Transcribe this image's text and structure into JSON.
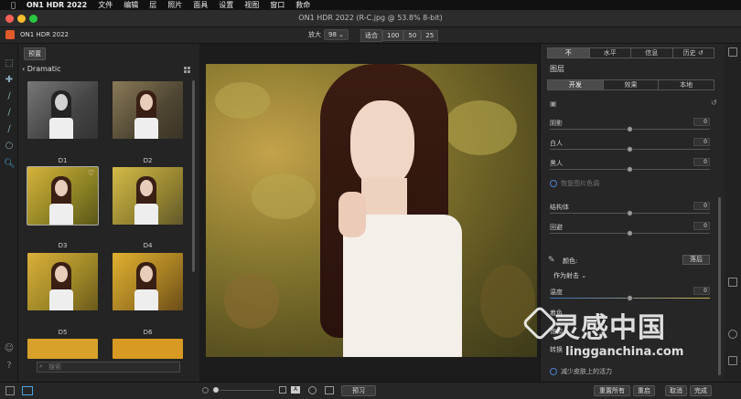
{
  "menubar": {
    "apple": "",
    "app": "ON1 HDR 2022",
    "items": [
      "文件",
      "编辑",
      "层",
      "照片",
      "面具",
      "设置",
      "视图",
      "窗口",
      "救命"
    ]
  },
  "window": {
    "title": "ON1 HDR 2022 (R-C.jpg @ 53.8% 8-bit)"
  },
  "toolbar": {
    "app_name": "ON1 HDR 2022",
    "zoom_label": "放大",
    "zoom_value": "98",
    "fit_label": "适合",
    "zoom_options": [
      "100",
      "50",
      "25"
    ]
  },
  "browser": {
    "tab_label": "预置",
    "folder_name": "Dramatic",
    "thumbnails": [
      "D1",
      "D2",
      "D3",
      "D4",
      "D5",
      "D6"
    ],
    "search_placeholder": "搜索"
  },
  "right_panel": {
    "tabs": [
      "不",
      "水平",
      "信息",
      "历史"
    ],
    "layers_title": "图层",
    "subtabs": [
      "开发",
      "效果",
      "本地"
    ],
    "sliders": [
      {
        "label": "阴影",
        "value": "0",
        "position": 0.5
      },
      {
        "label": "白人",
        "value": "0",
        "position": 0.5
      },
      {
        "label": "黑人",
        "value": "0",
        "position": 0.5
      },
      {
        "label": "结构体",
        "value": "0",
        "position": 0.5
      },
      {
        "label": "回避",
        "value": "0",
        "position": 0.5
      },
      {
        "label": "温度",
        "value": "0",
        "position": 0.5
      }
    ],
    "auto_toggle": "恢复图片色调",
    "color_label": "颜色:",
    "color_button": "落后",
    "color_mode": "作为射击",
    "more_labels": [
      "着色",
      "饱和",
      "转换"
    ],
    "skin_option": "减少皮肤上的活力"
  },
  "bottombar": {
    "preview_button": "预习",
    "reset_all_button": "重置所有",
    "reset_button": "重启",
    "cancel_button": "取消",
    "done_button": "完成"
  },
  "watermark": {
    "cn": "灵感中国",
    "en": "lingganchina.com"
  }
}
